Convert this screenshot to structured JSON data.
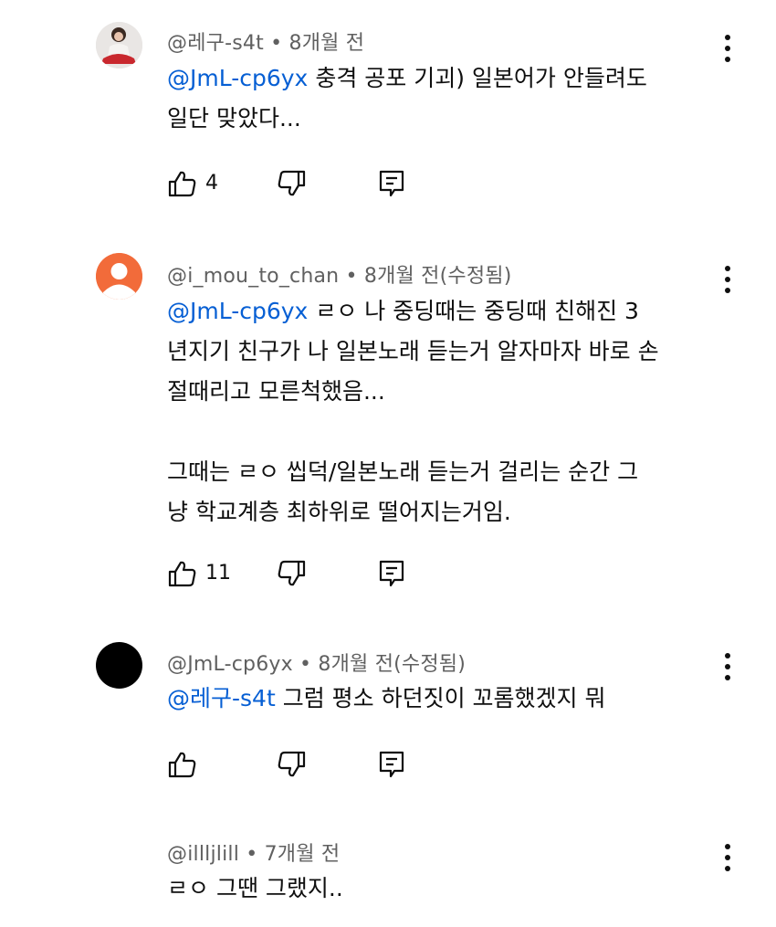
{
  "comments": [
    {
      "author": "@레구-s4t",
      "time": "8개월 전",
      "mention": "@JmL-cp6yx",
      "lines": [
        "충격 공포 기괴) 일본어가 안들려도",
        "일단 맞았다..."
      ],
      "likes": "4",
      "avatar": "photo"
    },
    {
      "author": "@i_mou_to_chan",
      "time": "8개월 전(수정됨)",
      "mention": "@JmL-cp6yx",
      "lines": [
        "ㄹㅇ 나 중딩때는 중딩때 친해진 3",
        "년지기 친구가 나 일본노래 듣는거 알자마자 바로 손",
        "절때리고 모른척했음...",
        "",
        "그때는 ㄹㅇ 씹덕/일본노래 듣는거 걸리는 순간 그",
        "냥 학교계층 최하위로 떨어지는거임."
      ],
      "likes": "11",
      "avatar": "default-orange"
    },
    {
      "author": "@JmL-cp6yx",
      "time": "8개월 전(수정됨)",
      "mention": "@레구-s4t",
      "lines": [
        "그럼 평소 하던짓이 꼬롬했겠지 뭐"
      ],
      "likes": "",
      "avatar": "black"
    },
    {
      "author": "@illljlill",
      "time": "7개월 전",
      "mention": "",
      "lines": [
        "ㄹㅇ 그땐 그랬지.."
      ],
      "likes": "",
      "avatar": "none"
    }
  ],
  "separator": "•",
  "icons": [
    "like-icon",
    "dislike-icon",
    "reply-icon",
    "more-options-icon"
  ],
  "colors": {
    "mention": "#065fd4",
    "meta": "#606060",
    "text": "#0f0f0f",
    "avatar_orange": "#f26b3a",
    "avatar_black": "#000000"
  }
}
